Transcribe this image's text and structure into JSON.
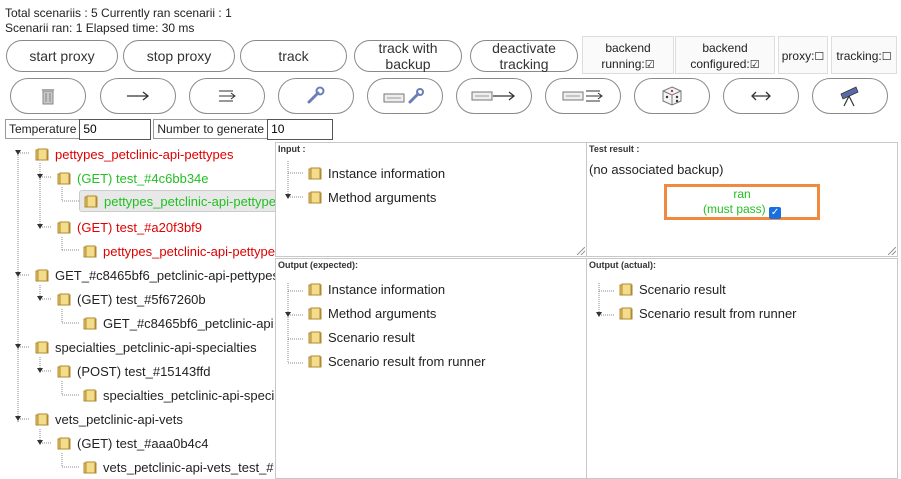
{
  "stats": {
    "line1": "Total scenariis : 5 Currently ran scenarii : 1",
    "line2": "Scenarii ran: 1   Elapsed time: 30 ms"
  },
  "buttons": {
    "start_proxy": "start proxy",
    "stop_proxy": "stop proxy",
    "track": "track",
    "track_with_backup_1": "track with",
    "track_with_backup_2": "backup",
    "deactivate_tracking_1": "deactivate",
    "deactivate_tracking_2": "tracking"
  },
  "status": {
    "backend_running_1": "backend",
    "backend_running_2": "running:",
    "backend_configured_1": "backend",
    "backend_configured_2": "configured:",
    "proxy": "proxy:",
    "tracking": "tracking:",
    "checked_glyph": "☑",
    "unchecked_glyph": "☐"
  },
  "icon_buttons": [
    "trash-icon",
    "arrow-right-icon",
    "arrow-right-multi-icon",
    "wrench-icon",
    "keyboard-wrench-icon",
    "keyboard-arrow-icon",
    "keyboard-arrow-multi-icon",
    "dice-icon",
    "arrow-both-icon",
    "telescope-icon"
  ],
  "params": {
    "temperature_label": "Temperature",
    "temperature_value": "50",
    "number_label": "Number to generate",
    "number_value": "10"
  },
  "tree": [
    "pettypes_petclinic-api-pettypes",
    "(GET) test_#4c6bb34e",
    "pettypes_petclinic-api-pettype",
    "(GET) test_#a20f3bf9",
    "pettypes_petclinic-api-pettype",
    "GET_#c8465bf6_petclinic-api-pettypes",
    "(GET) test_#5f67260b",
    "GET_#c8465bf6_petclinic-api",
    "specialties_petclinic-api-specialties",
    "(POST) test_#15143ffd",
    "specialties_petclinic-api-speci",
    "vets_petclinic-api-vets",
    "(GET) test_#aaa0b4c4",
    "vets_petclinic-api-vets_test_#"
  ],
  "input_panel": {
    "title": "Input :",
    "items": [
      "Instance information",
      "Method arguments"
    ]
  },
  "test_result": {
    "title": "Test result :",
    "note": "(no associated backup)",
    "ran": "ran",
    "must_pass": "(must pass)"
  },
  "output_expected": {
    "title": "Output (expected):",
    "items": [
      "Instance information",
      "Method arguments",
      "Scenario result",
      "Scenario result from runner"
    ]
  },
  "output_actual": {
    "title": "Output (actual):",
    "items": [
      "Scenario result",
      "Scenario result from runner"
    ]
  },
  "colors": {
    "error": "#e00000",
    "success": "#22c022",
    "highlight": "#f08a40"
  }
}
